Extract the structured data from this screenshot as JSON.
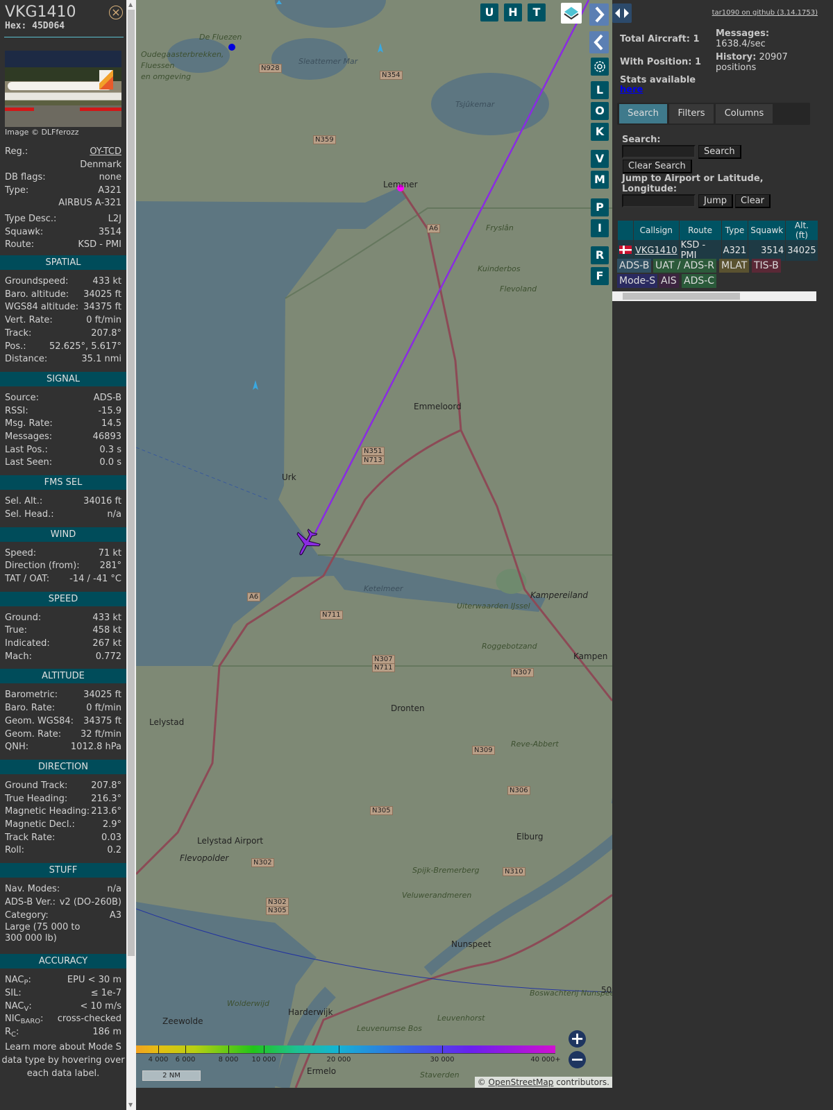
{
  "sidebar": {
    "callsign": "VKG1410",
    "hex": "Hex: 45D064",
    "close_icon": "close-circle-icon",
    "image_caption": "Image © DLFferozz",
    "info": [
      {
        "label": "Reg.:",
        "value": "OY-TCD"
      },
      {
        "label": "",
        "value": "Denmark"
      },
      {
        "label": "DB flags:",
        "value": "none"
      },
      {
        "label": "Type:",
        "value": "A321"
      },
      {
        "label": "",
        "value": "AIRBUS A-321"
      },
      {
        "label": "Type Desc.:",
        "value": "L2J"
      },
      {
        "label": "Squawk:",
        "value": "3514"
      },
      {
        "label": "Route:",
        "value": "KSD - PMI"
      }
    ],
    "sections": [
      {
        "title": "SPATIAL",
        "rows": [
          [
            "Groundspeed:",
            "433 kt"
          ],
          [
            "Baro. altitude:",
            "34025 ft"
          ],
          [
            "WGS84 altitude:",
            "34375 ft"
          ],
          [
            "Vert. Rate:",
            "0 ft/min"
          ],
          [
            "Track:",
            "207.8°"
          ],
          [
            "Pos.:",
            "52.625°, 5.617°"
          ],
          [
            "Distance:",
            "35.1 nmi"
          ]
        ]
      },
      {
        "title": "SIGNAL",
        "rows": [
          [
            "Source:",
            "ADS-B"
          ],
          [
            "RSSI:",
            "-15.9"
          ],
          [
            "Msg. Rate:",
            "14.5"
          ],
          [
            "Messages:",
            "46893"
          ],
          [
            "Last Pos.:",
            "0.3 s"
          ],
          [
            "Last Seen:",
            "0.0 s"
          ]
        ]
      },
      {
        "title": "FMS SEL",
        "rows": [
          [
            "Sel. Alt.:",
            "34016 ft"
          ],
          [
            "Sel. Head.:",
            "n/a"
          ]
        ]
      },
      {
        "title": "WIND",
        "rows": [
          [
            "Speed:",
            "71 kt"
          ],
          [
            "Direction (from):",
            "281°"
          ],
          [
            "TAT / OAT:",
            "-14 / -41 °C"
          ]
        ]
      },
      {
        "title": "SPEED",
        "rows": [
          [
            "Ground:",
            "433 kt"
          ],
          [
            "True:",
            "458 kt"
          ],
          [
            "Indicated:",
            "267 kt"
          ],
          [
            "Mach:",
            "0.772"
          ]
        ]
      },
      {
        "title": "ALTITUDE",
        "rows": [
          [
            "Barometric:",
            "34025 ft"
          ],
          [
            "Baro. Rate:",
            "0 ft/min"
          ],
          [
            "Geom. WGS84:",
            "34375 ft"
          ],
          [
            "Geom. Rate:",
            "32 ft/min"
          ],
          [
            "QNH:",
            "1012.8 hPa"
          ]
        ]
      },
      {
        "title": "DIRECTION",
        "rows": [
          [
            "Ground Track:",
            "207.8°"
          ],
          [
            "True Heading:",
            "216.3°"
          ],
          [
            "Magnetic Heading:",
            "213.6°"
          ],
          [
            "Magnetic Decl.:",
            "2.9°"
          ],
          [
            "Track Rate:",
            "0.03"
          ],
          [
            "Roll:",
            "0.2"
          ]
        ]
      },
      {
        "title": "STUFF",
        "rows": [
          [
            "Nav. Modes:",
            "n/a"
          ],
          [
            "ADS-B Ver.:",
            "v2 (DO-260B)"
          ],
          [
            "Category:",
            "A3"
          ]
        ],
        "extra": "Large (75 000 to 300 000 lb)"
      },
      {
        "title": "ACCURACY",
        "rows": [
          [
            "NAC",
            "P",
            ":",
            "EPU < 30 m"
          ],
          [
            "SIL:",
            "",
            "",
            "≤ 1e-7"
          ],
          [
            "NAC",
            "V",
            ":",
            "< 10 m/s"
          ],
          [
            "NIC",
            "BARO",
            ":",
            "cross-checked"
          ],
          [
            "R",
            "C",
            ":",
            "186 m"
          ]
        ]
      }
    ],
    "learn_more": "Learn more about Mode S data type by hovering over each data label."
  },
  "map": {
    "buttons_top": [
      "U",
      "H",
      "T"
    ],
    "buttons_side": [
      "L",
      "O",
      "K",
      "V",
      "M",
      "P",
      "I",
      "R",
      "F"
    ],
    "layers_icon": "layers-icon",
    "settings_icon": "gear-icon",
    "scale": "2 NM",
    "attribution_prefix": "© ",
    "attribution_link": "OpenStreetMap",
    "attribution_suffix": " contributors.",
    "altitude_legend": [
      "4 000",
      "6 000",
      "8 000",
      "10 000",
      "20 000",
      "30 000",
      "40 000+"
    ],
    "aircraft_track_color": "#8a2be2",
    "labels": [
      "Oudegaasterbrekken,",
      "Fluessen",
      "en omgeving",
      "De Fluezen",
      "Sleattemer Mar",
      "N928",
      "N354",
      "Tsjûkemar",
      "N359",
      "Lemmer",
      "A6",
      "Fryslân",
      "Kuinderbos",
      "Flevoland",
      "Emmeloord",
      "N351",
      "N713",
      "Urk",
      "Ketelmeer",
      "Kampereiland",
      "Uiterwaarden IJssel",
      "N711",
      "A6",
      "Roggebotzand",
      "N307",
      "N711",
      "N307",
      "Kampen",
      "Dronten",
      "Lelystad",
      "N309",
      "Reve-Abbert",
      "N306",
      "N305",
      "Lelystad Airport",
      "Flevopolder",
      "N302",
      "Elburg",
      "N310",
      "Spijk-Bremerberg",
      "Veluwerandmeren",
      "N302",
      "N305",
      "Nunspeet",
      "Wolderwijd",
      "Harderwijk",
      "Zeewolde",
      "Leuvenhorst",
      "Leuvenumse Bos",
      "Ermelo",
      "Staverden",
      "Boswachterij Nunspeet",
      "50"
    ]
  },
  "right": {
    "github_link": "tar1090 on github (3.14.1753)",
    "total_aircraft": "Total Aircraft: 1",
    "with_position": "With Position: 1",
    "stats_available": "Stats available",
    "stats_link": "here",
    "messages_label": "Messages:",
    "messages_value": "1638.4/sec",
    "history_label": "History:",
    "history_value": "20907 positions",
    "tabs": [
      "Search",
      "Filters",
      "Columns"
    ],
    "search_label": "Search:",
    "search_placeholder": "",
    "search_button": "Search",
    "clear_search_button": "Clear Search",
    "jump_label": "Jump to Airport or Latitude, Longitude:",
    "jump_button": "Jump",
    "clear_button": "Clear",
    "table": {
      "headers": [
        "",
        "Callsign",
        "Route",
        "Type",
        "Squawk",
        "Alt. (ft)"
      ],
      "rows": [
        {
          "flag": "Denmark",
          "callsign": "VKG1410",
          "route": "KSD - PMI",
          "type": "A321",
          "squawk": "3514",
          "alt": "34025"
        }
      ]
    },
    "legend": [
      {
        "label": "ADS-B",
        "color": "#2f4f62"
      },
      {
        "label": "UAT / ADS-R",
        "color": "#2c5a3a"
      },
      {
        "label": "MLAT",
        "color": "#5a5230"
      },
      {
        "label": "TIS-B",
        "color": "#5a2836"
      },
      {
        "label": "Mode-S",
        "color": "#2a2a60"
      },
      {
        "label": "AIS",
        "color": "#3c2440"
      },
      {
        "label": "ADS-C",
        "color": "#2a5a3a"
      }
    ]
  }
}
